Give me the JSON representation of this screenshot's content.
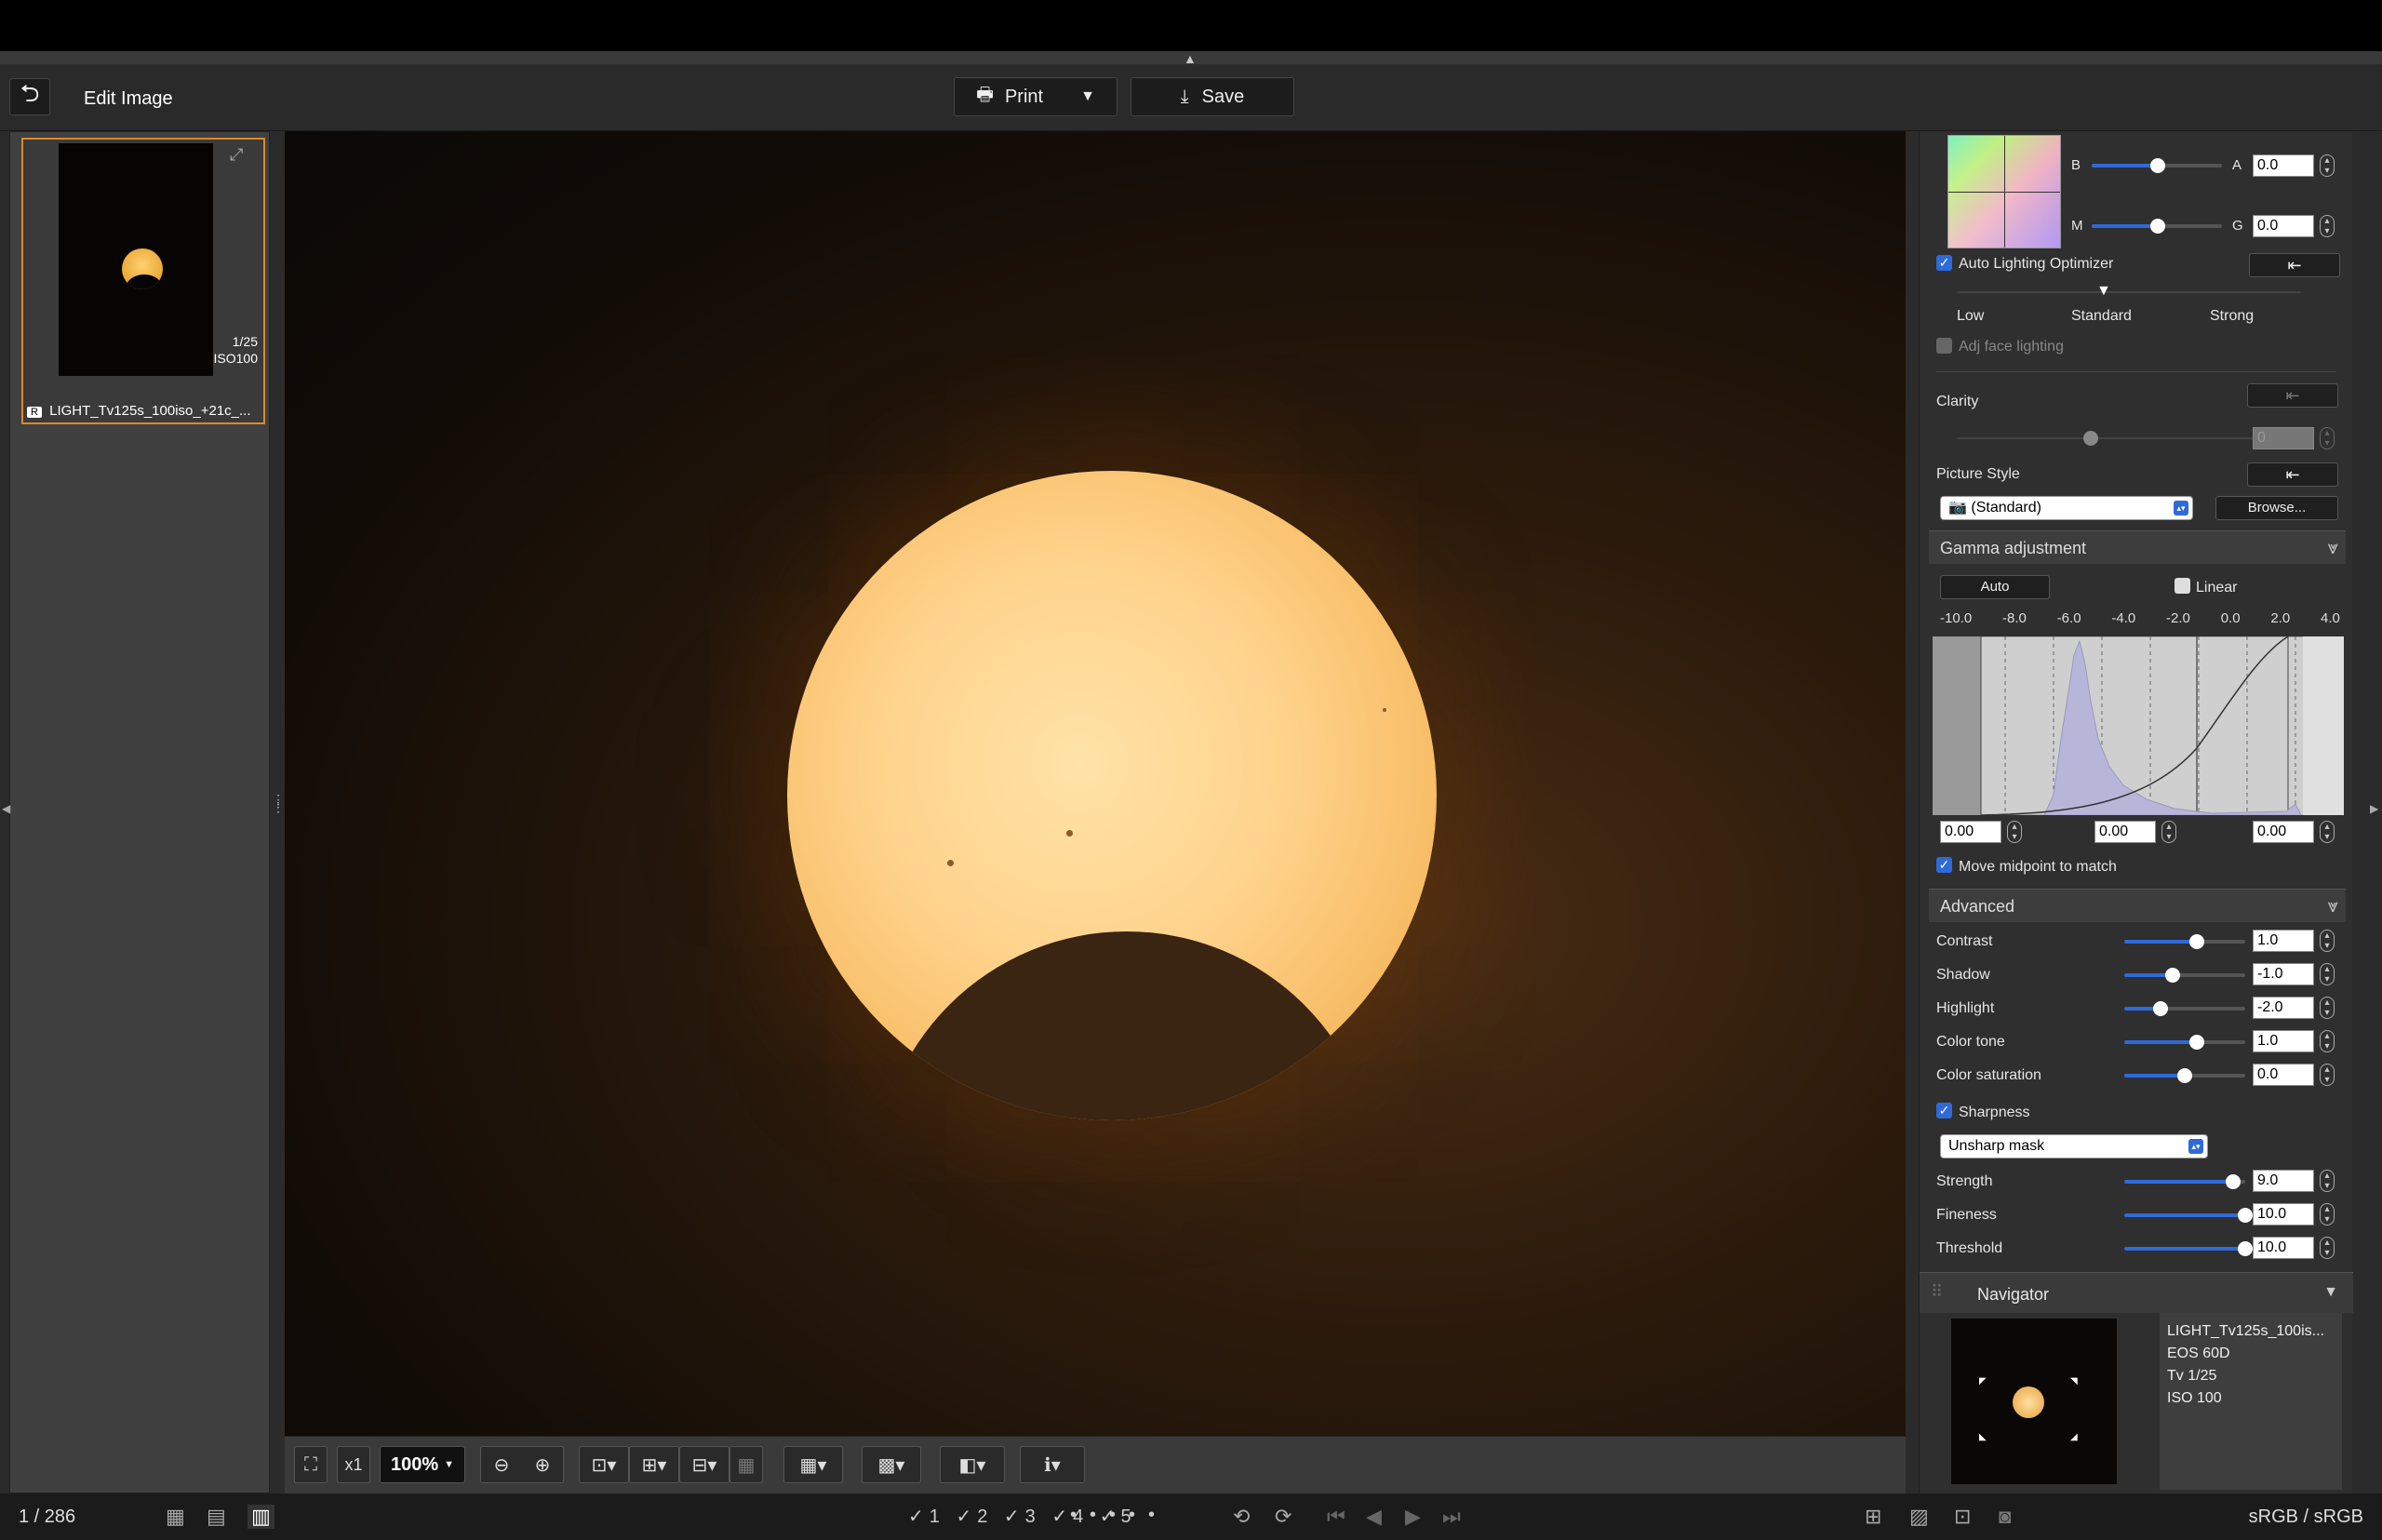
{
  "toolbar": {
    "title": "Edit Image",
    "print_label": "Print",
    "save_label": "Save"
  },
  "thumbnail": {
    "tv": "1/25",
    "iso": "ISO100",
    "filename": "LIGHT_Tv125s_100iso_+21c_..."
  },
  "canvas_toolbar": {
    "zoom_mult": "x1",
    "zoom": "100%"
  },
  "right_panel": {
    "color_b_label": "B",
    "color_a_label": "A",
    "color_m_label": "M",
    "color_g_label": "G",
    "color_ba_value": "0.0",
    "color_mg_value": "0.0",
    "alo_label": "Auto Lighting Optimizer",
    "alo_levels": [
      "Low",
      "Standard",
      "Strong"
    ],
    "adj_face_label": "Adj face lighting",
    "clarity_label": "Clarity",
    "clarity_value": "0",
    "picture_style_label": "Picture Style",
    "picture_style_value": "(Standard)",
    "browse_label": "Browse...",
    "gamma_header": "Gamma adjustment",
    "auto_label": "Auto",
    "linear_label": "Linear",
    "gamma_ticks": [
      "-10.0",
      "-8.0",
      "-6.0",
      "-4.0",
      "-2.0",
      "0.0",
      "2.0",
      "4.0"
    ],
    "gamma_black": "0.00",
    "gamma_mid": "0.00",
    "gamma_white": "0.00",
    "move_midpoint_label": "Move midpoint to match",
    "advanced_header": "Advanced",
    "advanced": [
      {
        "label": "Contrast",
        "value": "1.0",
        "pos": 0.6
      },
      {
        "label": "Shadow",
        "value": "-1.0",
        "pos": 0.4
      },
      {
        "label": "Highlight",
        "value": "-2.0",
        "pos": 0.3
      },
      {
        "label": "Color tone",
        "value": "1.0",
        "pos": 0.6
      },
      {
        "label": "Color saturation",
        "value": "0.0",
        "pos": 0.5
      }
    ],
    "sharpness_label": "Sharpness",
    "sharpness_mode": "Unsharp mask",
    "sharp": [
      {
        "label": "Strength",
        "value": "9.0",
        "pos": 0.9
      },
      {
        "label": "Fineness",
        "value": "10.0",
        "pos": 1.0
      },
      {
        "label": "Threshold",
        "value": "10.0",
        "pos": 1.0
      }
    ],
    "navigator_header": "Navigator",
    "nav_info": [
      "LIGHT_Tv125s_100is...",
      "EOS 60D",
      "Tv 1/25",
      "ISO 100"
    ]
  },
  "status": {
    "counter": "1 / 286",
    "color_space": "sRGB / sRGB"
  }
}
